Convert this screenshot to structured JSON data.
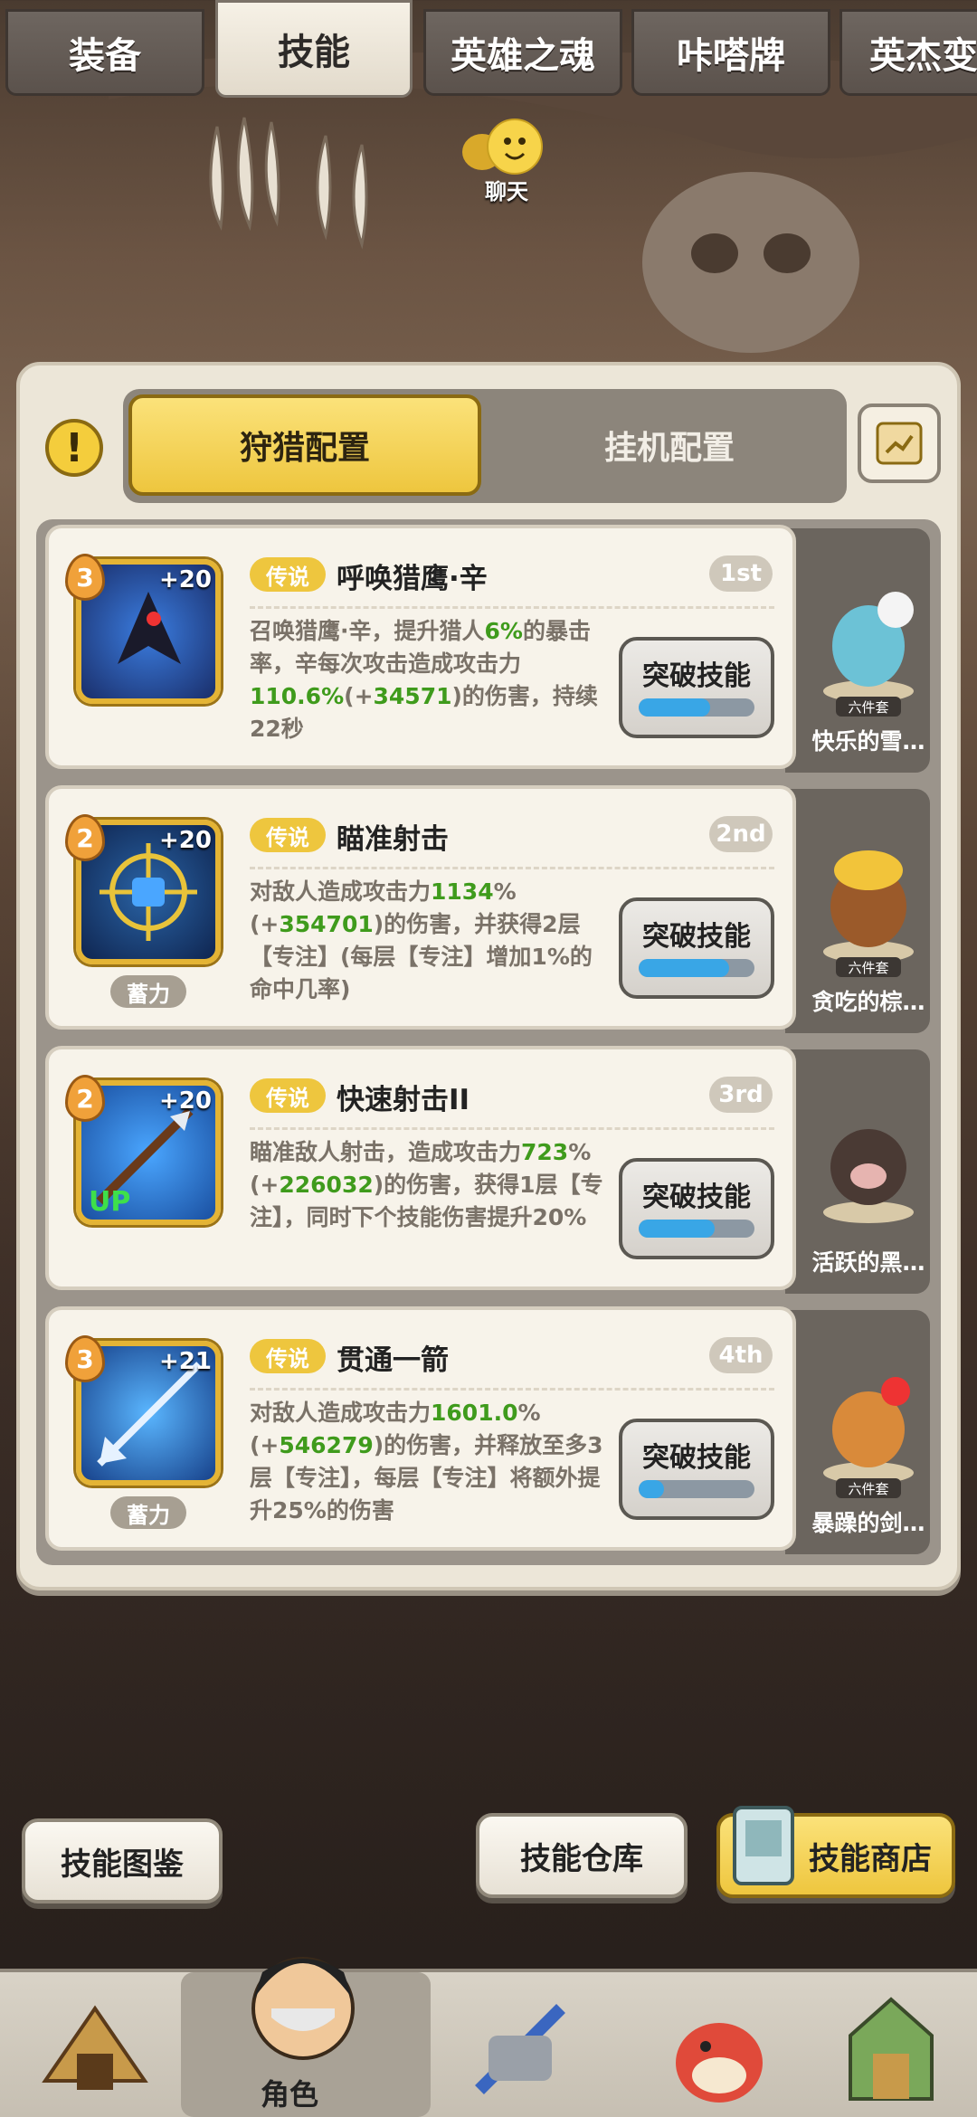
{
  "top_tabs": [
    {
      "label": "装备",
      "active": false
    },
    {
      "label": "技能",
      "active": true
    },
    {
      "label": "英雄之魂",
      "active": false
    },
    {
      "label": "咔嗒牌",
      "active": false
    },
    {
      "label": "英杰变",
      "active": false
    }
  ],
  "chat": {
    "label": "聊天",
    "icon": "chat-bubble-icon"
  },
  "config_tabs": {
    "hunting": "狩猎配置",
    "idle": "挂机配置",
    "active": "hunting"
  },
  "skills": [
    {
      "level": "3",
      "plus": "+20",
      "rarity": "传说",
      "name": "呼唤猎鹰·辛",
      "rank": "1st",
      "desc_parts": [
        "召唤猎鹰·辛，提升猎人",
        "6%",
        "的暴击率，辛每次攻击造成攻击力",
        "110.6%",
        "(+",
        "34571",
        ")的伤害，持续22秒"
      ],
      "charge": "",
      "break_label": "突破技能",
      "progress": 0.62,
      "pet": "快乐的雪…",
      "pet_set": "六件套"
    },
    {
      "level": "2",
      "plus": "+20",
      "rarity": "传说",
      "name": "瞄准射击",
      "rank": "2nd",
      "desc_parts": [
        "对敌人造成攻击力",
        "1134",
        "%(+",
        "354701",
        ")的伤害，并获得2层【专注】(每层【专注】增加1%的命中几率)"
      ],
      "charge": "蓄力",
      "break_label": "突破技能",
      "progress": 0.78,
      "pet": "贪吃的棕…",
      "pet_set": "六件套"
    },
    {
      "level": "2",
      "plus": "+20",
      "rarity": "传说",
      "name": "快速射击II",
      "rank": "3rd",
      "desc_parts": [
        "瞄准敌人射击，造成攻击力",
        "723",
        "%(+",
        "226032",
        ")的伤害，获得1层【专注】，同时下个技能伤害提升20%"
      ],
      "charge": "",
      "break_label": "突破技能",
      "progress": 0.66,
      "pet": "活跃的黑…",
      "pet_set": "六件套",
      "up_badge": "UP"
    },
    {
      "level": "3",
      "plus": "+21",
      "rarity": "传说",
      "name": "贯通一箭",
      "rank": "4th",
      "desc_parts": [
        "对敌人造成攻击力",
        "1601.0",
        "%(+",
        "546279",
        ")的伤害，并释放至多3层【专注】，每层【专注】将额外提升25%的伤害"
      ],
      "charge": "蓄力",
      "break_label": "突破技能",
      "progress": 0.22,
      "pet": "暴躁的剑…",
      "pet_set": "六件套"
    }
  ],
  "bottom_buttons": {
    "codex": "技能图鉴",
    "storage": "技能仓库",
    "shop": "技能商店"
  },
  "nav": {
    "active_label": "角色",
    "items": [
      "hut-icon",
      "character-icon",
      "weapon-icon",
      "pet-icon",
      "guild-icon"
    ]
  },
  "colors": {
    "gold": "#eec63e",
    "green": "#3f9b1c",
    "progress": "#39a6e6"
  }
}
